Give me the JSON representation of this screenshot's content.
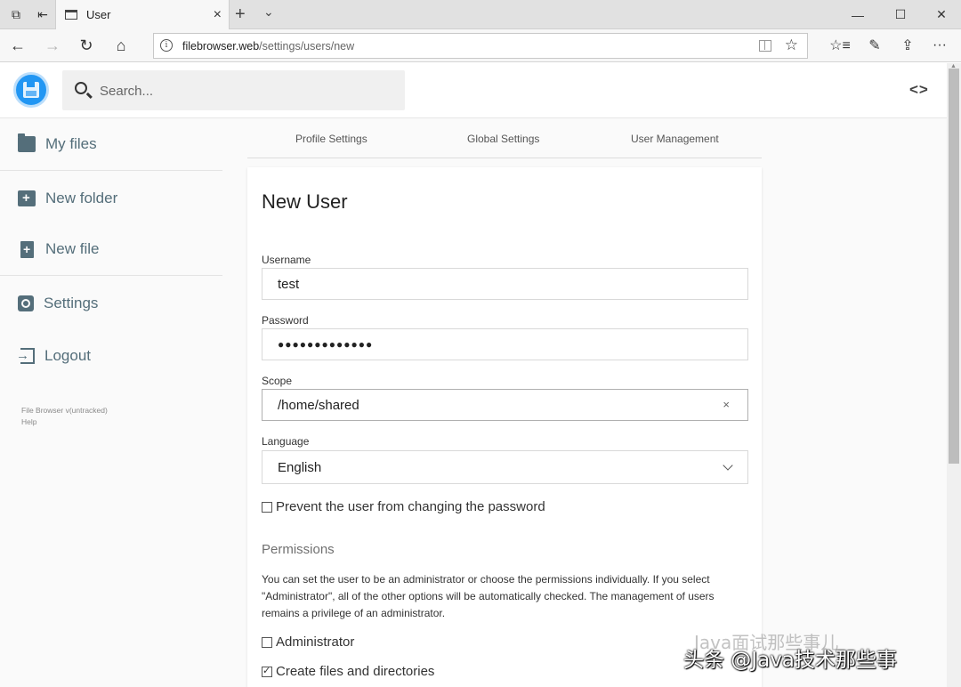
{
  "browser": {
    "tab_title": "User",
    "url_domain": "filebrowser.web",
    "url_path": "/settings/users/new",
    "new_tab": "+",
    "tab_menu": "⌄",
    "close_tab": "×",
    "minimize": "—",
    "maximize": "☐",
    "close_window": "✕",
    "back": "←",
    "forward": "→",
    "refresh": "↻",
    "home": "⌂",
    "favorite": "☆",
    "favorites_list": "☆≡",
    "notes": "✎",
    "share": "⇪",
    "more": "···"
  },
  "header": {
    "search_placeholder": "Search...",
    "code_label": "<>"
  },
  "sidebar": {
    "items": [
      {
        "label": "My files",
        "icon": "folder-icon"
      },
      {
        "label": "New folder",
        "icon": "create-new-folder-icon"
      },
      {
        "label": "New file",
        "icon": "note-add-icon"
      },
      {
        "label": "Settings",
        "icon": "settings-icon"
      },
      {
        "label": "Logout",
        "icon": "exit-icon"
      }
    ],
    "footer_version": "File Browser v(untracked)",
    "footer_help": "Help"
  },
  "settings_tabs": [
    "Profile Settings",
    "Global Settings",
    "User Management"
  ],
  "form": {
    "title": "New User",
    "username_label": "Username",
    "username_value": "test",
    "password_label": "Password",
    "password_value": "●●●●●●●●●●●●●",
    "scope_label": "Scope",
    "scope_value": "/home/shared",
    "scope_clear": "×",
    "language_label": "Language",
    "language_value": "English",
    "lock_password_label": "Prevent the user from changing the password",
    "lock_password_checked": false,
    "permissions_heading": "Permissions",
    "permissions_description": "You can set the user to be an administrator or choose the permissions individually. If you select \"Administrator\", all of the other options will be automatically checked. The management of users remains a privilege of an administrator.",
    "administrator_label": "Administrator",
    "administrator_checked": false,
    "create_label": "Create files and directories",
    "create_checked": true
  },
  "watermark": {
    "main": "头条 @Java技术那些事",
    "faint": "Java面试那些事儿"
  },
  "colors": {
    "accent": "#2196f3",
    "sidebar_text": "#546e7a"
  }
}
